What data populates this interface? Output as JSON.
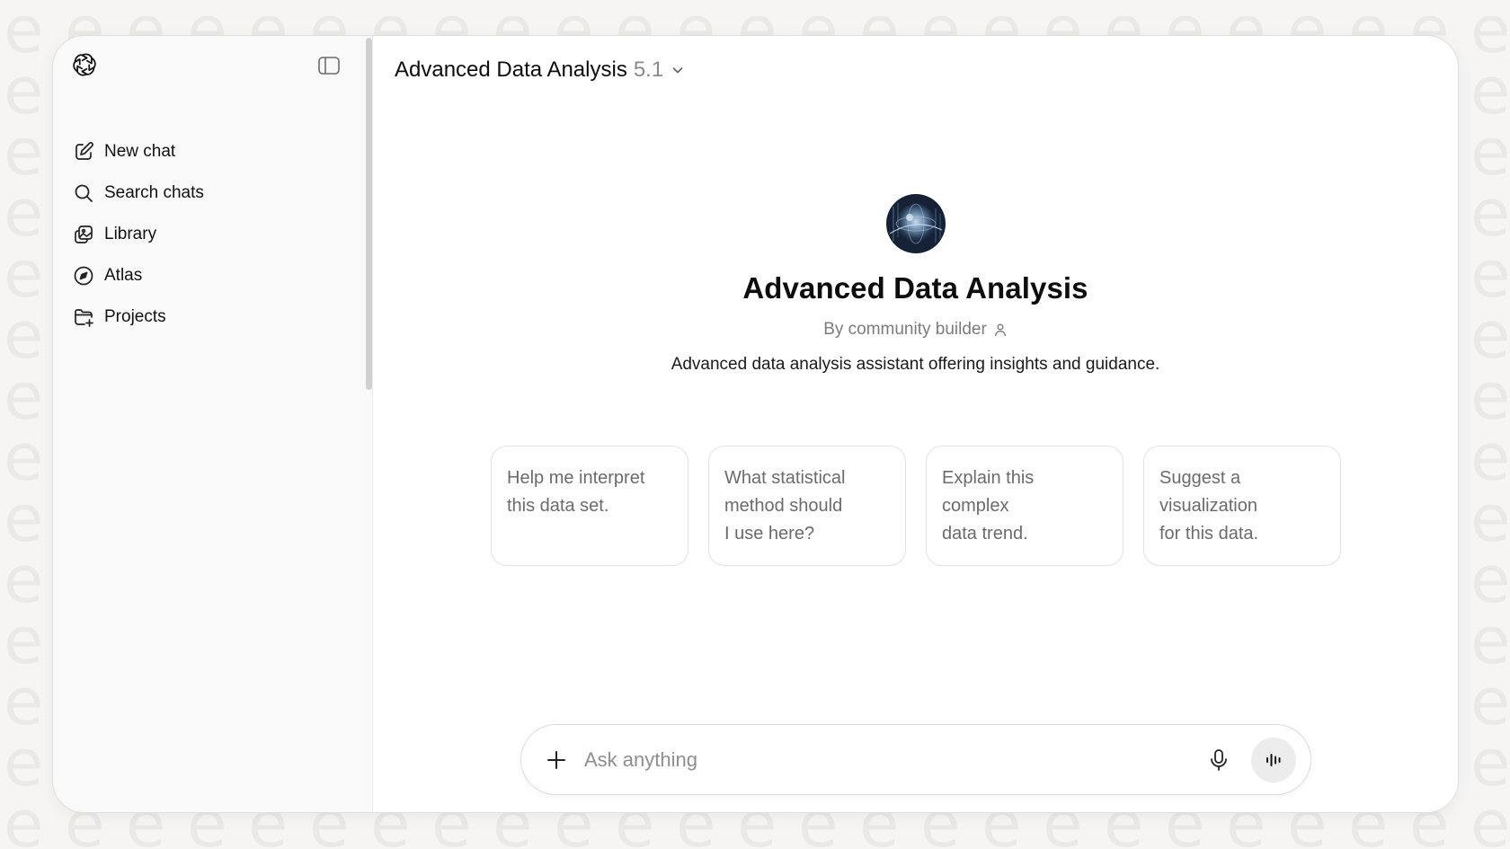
{
  "sidebar": {
    "logo_icon": "openai-logo-icon",
    "toggle_icon": "sidebar-toggle-icon",
    "items": [
      {
        "label": "New chat",
        "icon": "compose-icon"
      },
      {
        "label": "Search chats",
        "icon": "search-icon"
      },
      {
        "label": "Library",
        "icon": "library-icon"
      },
      {
        "label": "Atlas",
        "icon": "compass-icon"
      },
      {
        "label": "Projects",
        "icon": "folder-plus-icon"
      }
    ]
  },
  "header": {
    "model_name": "Advanced Data Analysis",
    "model_version": "5.1",
    "chevron_icon": "chevron-down-icon"
  },
  "gpt": {
    "avatar_icon": "globe-data-avatar",
    "title": "Advanced Data Analysis",
    "author": "By community builder",
    "author_icon": "person-icon",
    "description": "Advanced data analysis assistant offering insights and guidance."
  },
  "starters": [
    {
      "lines": [
        "Help me interpret",
        "this data set."
      ]
    },
    {
      "lines": [
        "What statistical",
        "method should",
        "I use here?"
      ]
    },
    {
      "lines": [
        "Explain this",
        "complex",
        "data trend."
      ]
    },
    {
      "lines": [
        "Suggest a",
        "visualization",
        "for this data."
      ]
    }
  ],
  "composer": {
    "placeholder": "Ask anything",
    "value": "",
    "plus_icon": "plus-icon",
    "mic_icon": "microphone-icon",
    "voice_icon": "voice-mode-icon"
  },
  "colors": {
    "page_background": "#f6f5f3",
    "sidebar_background": "#f9f9f9",
    "voice_button": "#ececec",
    "muted_text": "#6b6b6b"
  }
}
